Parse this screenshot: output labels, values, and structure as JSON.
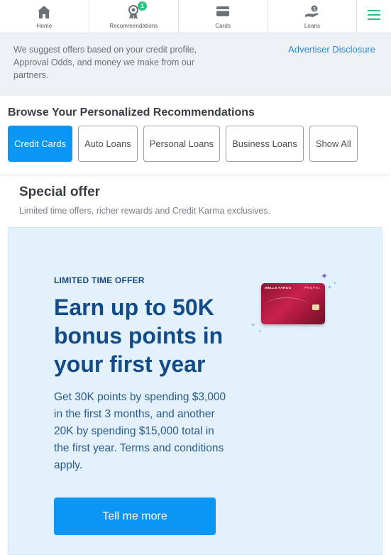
{
  "nav": {
    "items": [
      {
        "label": "Home",
        "icon": "home-icon"
      },
      {
        "label": "Recommendations",
        "icon": "recommendations-icon",
        "badge": "1"
      },
      {
        "label": "Cards",
        "icon": "credit-card-icon"
      },
      {
        "label": "Loans",
        "icon": "loan-icon"
      }
    ],
    "menu_icon": "hamburger-menu-icon",
    "accent": "#2ec27e"
  },
  "disclosure": {
    "text": "We suggest offers based on your credit profile, Approval Odds, and money we make from our partners.",
    "link": "Advertiser Disclosure"
  },
  "browse": {
    "title": "Browse Your Personalized Recommendations",
    "pills": [
      {
        "label": "Credit Cards",
        "active": true
      },
      {
        "label": "Auto Loans",
        "active": false
      },
      {
        "label": "Personal Loans",
        "active": false
      },
      {
        "label": "Business Loans",
        "active": false
      },
      {
        "label": "Show All",
        "active": false
      }
    ]
  },
  "special": {
    "title": "Special offer",
    "subtitle": "Limited time offers, richer rewards and Credit Karma exclusives."
  },
  "offer": {
    "eyebrow": "LIMITED TIME OFFER",
    "headline": "Earn up to 50K bonus points in your first year",
    "body": "Get 30K points by spending $3,000 in the first 3 months, and another 20K by spending $15,000 total in the first year. Terms and conditions apply.",
    "cta": "Tell me more",
    "card_brand": "WELLS FARGO",
    "card_product": "PROPEL",
    "primary_color": "#0a96f5"
  }
}
